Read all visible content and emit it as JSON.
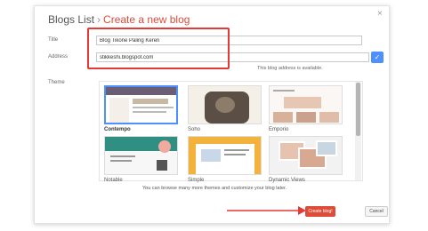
{
  "dialog": {
    "breadcrumb": "Blogs List",
    "separator": "›",
    "title": "Create a new blog",
    "close_glyph": "×"
  },
  "form": {
    "title_label": "Title",
    "title_value": "Blog Tikone Paling Keren",
    "address_label": "Address",
    "address_value": "stikkeshi.blogspot.com",
    "availability": "This blog address is available.",
    "check_icon": "check-icon"
  },
  "themes": {
    "label": "Theme",
    "items": [
      {
        "name": "Contempo",
        "selected": true
      },
      {
        "name": "Soho",
        "selected": false
      },
      {
        "name": "Emporio",
        "selected": false
      },
      {
        "name": "Notable",
        "selected": false
      },
      {
        "name": "Simple",
        "selected": false
      },
      {
        "name": "Dynamic Views",
        "selected": false
      }
    ],
    "hint": "You can browse many more themes and customize your blog later."
  },
  "actions": {
    "create_label": "Create blog!",
    "cancel_label": "Cancel"
  },
  "colors": {
    "accent": "#dd4b39",
    "highlight": "#e53935",
    "selection": "#4d90fe"
  }
}
